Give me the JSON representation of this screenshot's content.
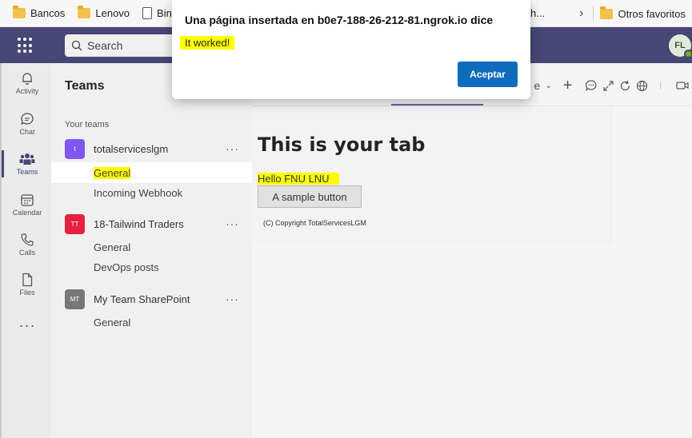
{
  "bookmarks": {
    "items": [
      {
        "label": "Bancos",
        "icon": "folder-icon"
      },
      {
        "label": "Lenovo",
        "icon": "folder-icon"
      },
      {
        "label": "Bing",
        "icon": "page-icon"
      }
    ],
    "partial_label": "h...",
    "other_favorites": "Otros favoritos"
  },
  "topbar": {
    "search_placeholder": "Search",
    "user_initials": "FL",
    "colors": {
      "bar": "#464775",
      "presence": "#6bb700"
    }
  },
  "rail": {
    "items": [
      {
        "label": "Activity",
        "icon": "bell-icon"
      },
      {
        "label": "Chat",
        "icon": "chat-icon"
      },
      {
        "label": "Teams",
        "icon": "teams-icon",
        "active": true
      },
      {
        "label": "Calendar",
        "icon": "calendar-icon"
      },
      {
        "label": "Calls",
        "icon": "phone-icon"
      },
      {
        "label": "Files",
        "icon": "file-icon"
      }
    ],
    "more": "···"
  },
  "panel": {
    "title": "Teams",
    "section_label": "Your teams",
    "teams": [
      {
        "avatar": "t",
        "name": "totalserviceslgm",
        "color": "#7f56f0",
        "channels": [
          {
            "label": "General",
            "selected": true,
            "highlighted": true
          },
          {
            "label": "Incoming Webhook"
          }
        ]
      },
      {
        "avatar": "TT",
        "name": "18-Tailwind Traders",
        "color": "#e8203f",
        "channels": [
          {
            "label": "General"
          },
          {
            "label": "DevOps posts"
          }
        ]
      },
      {
        "avatar": "MT",
        "name": "My Team SharePoint",
        "color": "#777777",
        "channels": [
          {
            "label": "General"
          }
        ]
      }
    ],
    "more": "···"
  },
  "tab": {
    "partial_label": "e",
    "heading": "This is your tab",
    "greeting": "Hello FNU LNU",
    "button_label": "A sample button",
    "copyright": "(C) Copyright TotalServicesLGM"
  },
  "dialog": {
    "title": "Una página insertada en b0e7-188-26-212-81.ngrok.io dice",
    "message": "It worked!",
    "button_label": "Aceptar",
    "highlight_color": "#ffff00",
    "button_color": "#0f6cbd"
  }
}
